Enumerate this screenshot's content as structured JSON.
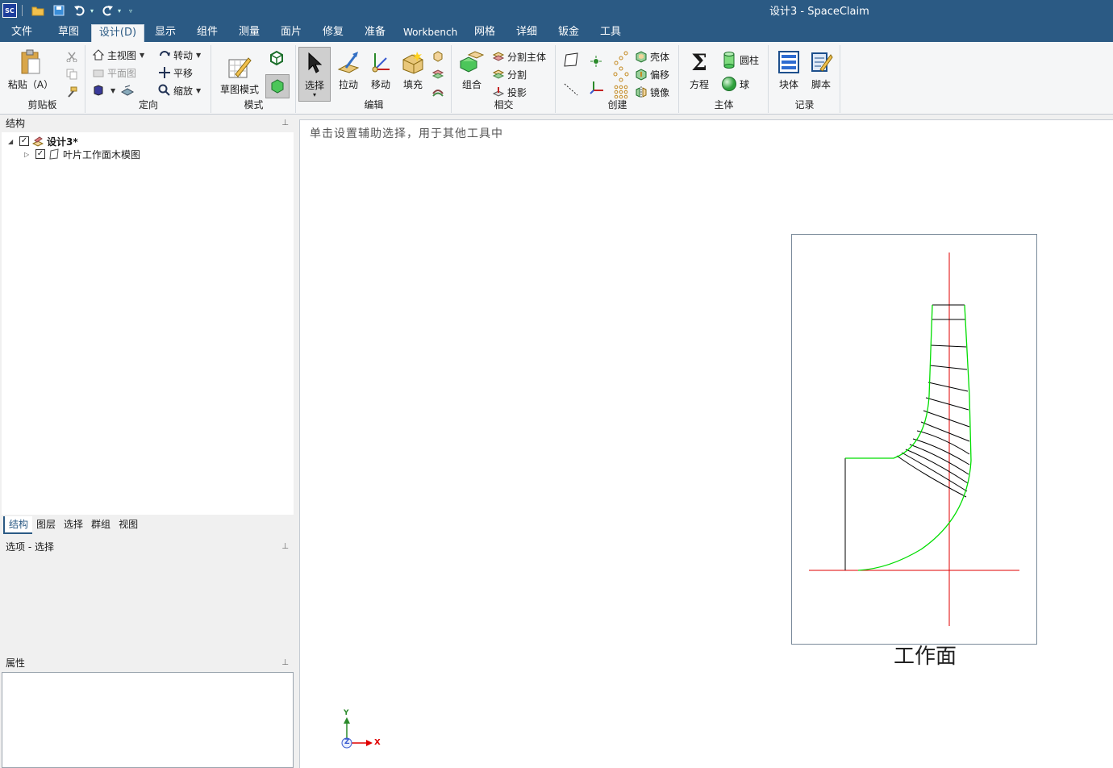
{
  "window": {
    "title": "设计3 - SpaceClaim",
    "logo_text": "SC"
  },
  "menu": {
    "tabs": [
      {
        "label": "文件"
      },
      {
        "label": "草图"
      },
      {
        "label": "设计(D)"
      },
      {
        "label": "显示"
      },
      {
        "label": "组件"
      },
      {
        "label": "测量"
      },
      {
        "label": "面片"
      },
      {
        "label": "修复"
      },
      {
        "label": "准备"
      },
      {
        "label": "Workbench"
      },
      {
        "label": "网格"
      },
      {
        "label": "详细"
      },
      {
        "label": "钣金"
      },
      {
        "label": "工具"
      }
    ],
    "active_tab": "设计(D)"
  },
  "ribbon": {
    "clipboard": {
      "label": "剪贴板",
      "paste": "粘贴（A）"
    },
    "orient": {
      "label": "定向",
      "home": "主视图",
      "plan": "平面图",
      "spin": "转动",
      "pan": "平移",
      "zoom": "缩放"
    },
    "mode": {
      "label": "模式",
      "sketch_mode": "草图模式"
    },
    "edit": {
      "label": "编辑",
      "select": "选择",
      "pull": "拉动",
      "move": "移动",
      "fill": "填充"
    },
    "intersect": {
      "label": "相交",
      "combine": "组合",
      "split_body": "分割主体",
      "split": "分割",
      "project": "投影"
    },
    "create": {
      "label": "创建",
      "shell": "壳体",
      "offset": "偏移",
      "mirror": "镜像"
    },
    "body": {
      "label": "主体",
      "equation": "方程",
      "cylinder": "圆柱",
      "sphere": "球"
    },
    "record": {
      "label": "记录",
      "block": "块体",
      "script": "脚本"
    }
  },
  "structure_panel": {
    "title": "结构",
    "items": [
      {
        "label": "设计3*",
        "checked": true,
        "expanded": true
      },
      {
        "label": "叶片工作面木模图",
        "checked": true,
        "expanded": false
      }
    ],
    "tabs": [
      "结构",
      "图层",
      "选择",
      "群组",
      "视图"
    ],
    "active_tab": "结构"
  },
  "options_panel": {
    "title": "选项 - 选择"
  },
  "properties_panel": {
    "title": "属性"
  },
  "viewport": {
    "hint": "单击设置辅助选择，用于其他工具中",
    "drawing_caption": "工作面",
    "triad": {
      "y": "Y",
      "z": "Z",
      "x": "X"
    },
    "colors": {
      "profile": "#00dd00",
      "axis": "#e00000",
      "lines": "#000000"
    }
  }
}
